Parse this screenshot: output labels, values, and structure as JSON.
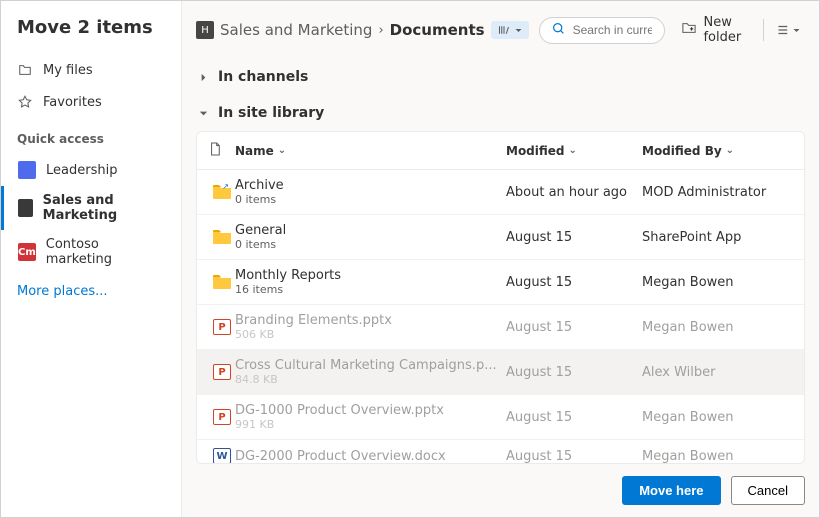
{
  "title": "Move 2 items",
  "sidebar": {
    "myFiles": "My files",
    "favorites": "Favorites",
    "quickAccessLabel": "Quick access",
    "items": [
      {
        "label": "Leadership",
        "color": "#4f6bed",
        "icon": "⬚"
      },
      {
        "label": "Sales and Marketing",
        "color": "#393939",
        "icon": "⬚"
      },
      {
        "label": "Contoso marketing",
        "color": "#d13438",
        "icon": "Cm"
      }
    ],
    "morePlaces": "More places..."
  },
  "breadcrumb": {
    "site": "Sales and Marketing",
    "library": "Documents"
  },
  "search": {
    "placeholder": "Search in current library"
  },
  "toolbar": {
    "newFolder": "New folder"
  },
  "sections": {
    "inChannels": "In channels",
    "inSiteLibrary": "In site library"
  },
  "columns": {
    "name": "Name",
    "modified": "Modified",
    "modifiedBy": "Modified By"
  },
  "rows": [
    {
      "type": "folder",
      "shortcut": true,
      "name": "Archive",
      "sub": "0 items",
      "modified": "About an hour ago",
      "modifiedBy": "MOD Administrator",
      "disabled": false
    },
    {
      "type": "folder",
      "shortcut": false,
      "name": "General",
      "sub": "0 items",
      "modified": "August 15",
      "modifiedBy": "SharePoint App",
      "disabled": false
    },
    {
      "type": "folder",
      "shortcut": false,
      "name": "Monthly Reports",
      "sub": "16 items",
      "modified": "August 15",
      "modifiedBy": "Megan Bowen",
      "disabled": false
    },
    {
      "type": "pptx",
      "shortcut": false,
      "name": "Branding Elements.pptx",
      "sub": "506 KB",
      "modified": "August 15",
      "modifiedBy": "Megan Bowen",
      "disabled": true
    },
    {
      "type": "pptx",
      "shortcut": false,
      "name": "Cross Cultural Marketing Campaigns.p...",
      "sub": "84.8 KB",
      "modified": "August 15",
      "modifiedBy": "Alex Wilber",
      "disabled": true,
      "highlight": true
    },
    {
      "type": "pptx",
      "shortcut": false,
      "name": "DG-1000 Product Overview.pptx",
      "sub": "991 KB",
      "modified": "August 15",
      "modifiedBy": "Megan Bowen",
      "disabled": true
    },
    {
      "type": "docx",
      "shortcut": false,
      "name": "DG-2000 Product Overview.docx",
      "sub": "",
      "modified": "August 15",
      "modifiedBy": "Megan Bowen",
      "disabled": true
    }
  ],
  "footer": {
    "moveHere": "Move here",
    "cancel": "Cancel"
  }
}
